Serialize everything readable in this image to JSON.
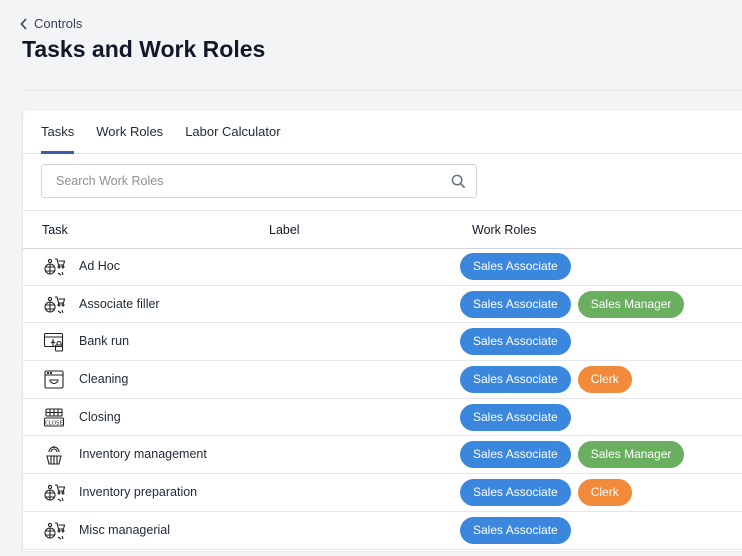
{
  "header": {
    "back_label": "Controls",
    "title": "Tasks and Work Roles"
  },
  "tabs": [
    {
      "label": "Tasks",
      "active": true
    },
    {
      "label": "Work Roles",
      "active": false
    },
    {
      "label": "Labor Calculator",
      "active": false
    }
  ],
  "search": {
    "placeholder": "Search Work Roles",
    "value": ""
  },
  "table": {
    "columns": [
      "Task",
      "Label",
      "Work Roles"
    ],
    "rows": [
      {
        "task": "Ad Hoc",
        "icon": "person-cart-icon",
        "roles": [
          {
            "name": "Sales Associate",
            "color": "blue"
          }
        ]
      },
      {
        "task": "Associate filler",
        "icon": "person-cart-icon",
        "roles": [
          {
            "name": "Sales Associate",
            "color": "blue"
          },
          {
            "name": "Sales Manager",
            "color": "green"
          }
        ]
      },
      {
        "task": "Bank run",
        "icon": "bank-run-icon",
        "roles": [
          {
            "name": "Sales Associate",
            "color": "blue"
          }
        ]
      },
      {
        "task": "Cleaning",
        "icon": "cleaning-icon",
        "roles": [
          {
            "name": "Sales Associate",
            "color": "blue"
          },
          {
            "name": "Clerk",
            "color": "orange"
          }
        ]
      },
      {
        "task": "Closing",
        "icon": "close-sign-icon",
        "roles": [
          {
            "name": "Sales Associate",
            "color": "blue"
          }
        ]
      },
      {
        "task": "Inventory management",
        "icon": "inventory-basket-icon",
        "roles": [
          {
            "name": "Sales Associate",
            "color": "blue"
          },
          {
            "name": "Sales Manager",
            "color": "green"
          }
        ]
      },
      {
        "task": "Inventory preparation",
        "icon": "person-cart-icon",
        "roles": [
          {
            "name": "Sales Associate",
            "color": "blue"
          },
          {
            "name": "Clerk",
            "color": "orange"
          }
        ]
      },
      {
        "task": "Misc managerial",
        "icon": "person-cart-icon",
        "roles": [
          {
            "name": "Sales Associate",
            "color": "blue"
          }
        ]
      }
    ]
  },
  "colors": {
    "blue": "#3b87dd",
    "green": "#6aaf5f",
    "orange": "#f18a3a",
    "tab_underline": "#3b5bab"
  }
}
